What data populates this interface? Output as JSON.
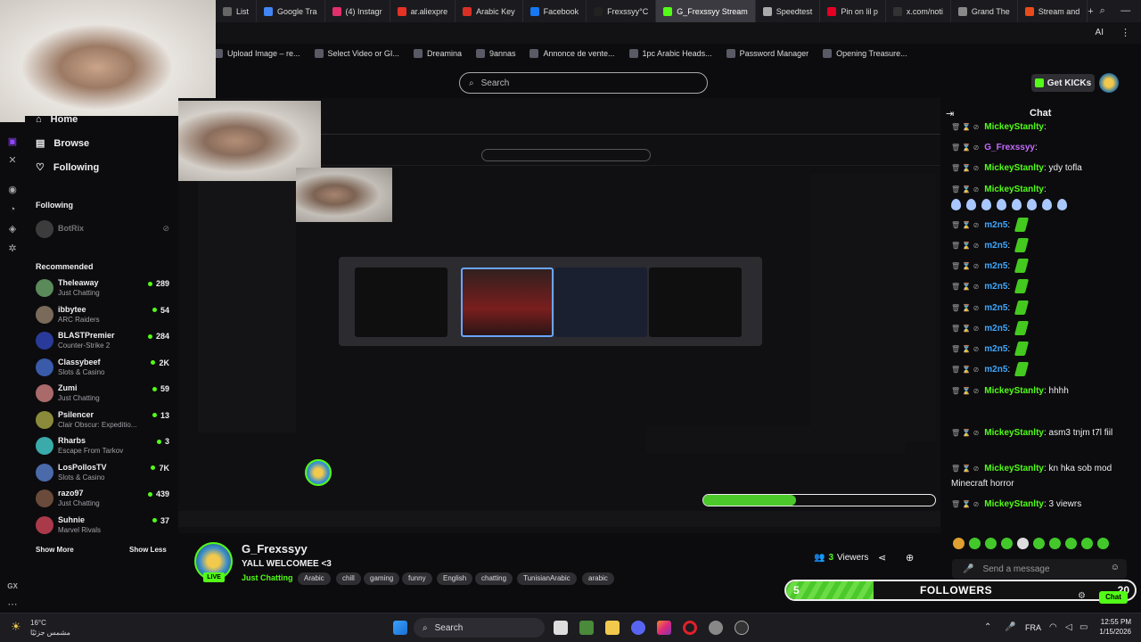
{
  "browser": {
    "tabs": [
      {
        "label": "List",
        "color": "#666"
      },
      {
        "label": "Google Tra",
        "color": "#4285f4"
      },
      {
        "label": "(4) Instagr",
        "color": "#e1306c"
      },
      {
        "label": "ar.aliexpre",
        "color": "#e43225"
      },
      {
        "label": "Arabic Key",
        "color": "#d93025"
      },
      {
        "label": "Facebook",
        "color": "#1877f2"
      },
      {
        "label": "Frexssyy°C",
        "color": "#222"
      },
      {
        "label": "G_Frexssyy Stream",
        "color": "#53fc18",
        "active": true
      },
      {
        "label": "Speedtest",
        "color": "#aaa"
      },
      {
        "label": "Pin on lil p",
        "color": "#e60023"
      },
      {
        "label": "x.com/noti",
        "color": "#333"
      },
      {
        "label": "Grand The",
        "color": "#888"
      },
      {
        "label": "Stream and",
        "color": "#e84a1b"
      }
    ],
    "bookmarks": [
      "Upload Image – re...",
      "Select Video or GI...",
      "Dreamina",
      "9annas",
      "Annonce de vente...",
      "1pc Arabic Heads...",
      "Password Manager",
      "Opening Treasure..."
    ],
    "ai_label": "AI"
  },
  "header": {
    "search_placeholder": "Search",
    "get_kicks": "Get KICKs"
  },
  "sidebar": {
    "nav": [
      {
        "label": "Home"
      },
      {
        "label": "Browse"
      },
      {
        "label": "Following"
      }
    ],
    "following_title": "Following",
    "following": [
      {
        "name": "BotRix"
      }
    ],
    "recommended_title": "Recommended",
    "channels": [
      {
        "name": "Theleaway",
        "category": "Just Chatting",
        "viewers": "289",
        "color": "#5a8a5a"
      },
      {
        "name": "ibbytee",
        "category": "ARC Raiders",
        "viewers": "54",
        "color": "#7a6a5a"
      },
      {
        "name": "BLASTPremier",
        "category": "Counter-Strike 2",
        "viewers": "284",
        "color": "#2a3a9a"
      },
      {
        "name": "Classybeef",
        "category": "Slots & Casino",
        "viewers": "2K",
        "color": "#3a5aaa"
      },
      {
        "name": "Zumi",
        "category": "Just Chatting",
        "viewers": "59",
        "color": "#aa6a6a"
      },
      {
        "name": "Psilencer",
        "category": "Clair Obscur: Expeditio...",
        "viewers": "13",
        "color": "#8a8a3a"
      },
      {
        "name": "Rharbs",
        "category": "Escape From Tarkov",
        "viewers": "3",
        "color": "#3aaaaa"
      },
      {
        "name": "LosPollosTV",
        "category": "Slots & Casino",
        "viewers": "7K",
        "color": "#4a6aaa"
      },
      {
        "name": "razo97",
        "category": "Just Chatting",
        "viewers": "439",
        "color": "#6a4a3a"
      },
      {
        "name": "Suhnie",
        "category": "Marvel Rivals",
        "viewers": "37",
        "color": "#aa3a4a"
      }
    ],
    "show_more": "Show More",
    "show_less": "Show Less",
    "gx": "GX"
  },
  "stream": {
    "name": "G_Frexssyy",
    "title": "YALL WELCOMEE <3",
    "live": "LIVE",
    "category": "Just Chatting",
    "tags": [
      "Arabic",
      "chill",
      "gaming",
      "funny",
      "English",
      "chatting",
      "TunisianArabic",
      "arabic"
    ],
    "viewers_num": "3",
    "viewers_label": "Viewers",
    "follow_goal": {
      "start": "5",
      "label": "FOLLOWERS",
      "end": "20",
      "progress": 0.25
    }
  },
  "chat": {
    "title": "Chat",
    "messages": [
      {
        "user": "MickeyStanlty",
        "text": "",
        "color": "#53fc18"
      },
      {
        "user": "G_Frexssyy",
        "text": "",
        "color": "#c56bff"
      },
      {
        "user": "MickeyStanlty",
        "text": "ydy tofla",
        "color": "#53fc18"
      },
      {
        "user": "MickeyStanlty",
        "text": "",
        "color": "#53fc18"
      },
      {
        "user": "m2n5",
        "text": "",
        "color": "#3fa7ff"
      },
      {
        "user": "m2n5",
        "text": "",
        "color": "#3fa7ff"
      },
      {
        "user": "m2n5",
        "text": "",
        "color": "#3fa7ff"
      },
      {
        "user": "m2n5",
        "text": "",
        "color": "#3fa7ff"
      },
      {
        "user": "m2n5",
        "text": "",
        "color": "#3fa7ff"
      },
      {
        "user": "m2n5",
        "text": "",
        "color": "#3fa7ff"
      },
      {
        "user": "m2n5",
        "text": "",
        "color": "#3fa7ff"
      },
      {
        "user": "m2n5",
        "text": "",
        "color": "#3fa7ff"
      },
      {
        "user": "MickeyStanlty",
        "text": "hhhh",
        "color": "#53fc18"
      },
      {
        "user": "MickeyStanlty",
        "text": "asm3 tnjm t7l fiil",
        "color": "#53fc18"
      },
      {
        "user": "MickeyStanlty",
        "text": "kn hka sob mod Minecraft horror",
        "color": "#53fc18"
      },
      {
        "user": "MickeyStanlty",
        "text": "3 viewrs",
        "color": "#53fc18"
      }
    ],
    "input_placeholder": "Send a message",
    "chat_button": "Chat"
  },
  "taskbar": {
    "temp": "16°C",
    "weather": "مشمس جزئيًا",
    "search": "Search",
    "lang": "FRA",
    "time": "12:55 PM",
    "date": "1/15/2026"
  }
}
